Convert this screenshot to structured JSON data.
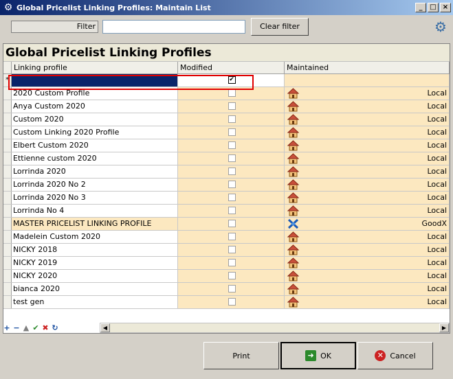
{
  "window": {
    "title": "Global Pricelist Linking Profiles: Maintain List",
    "app_icon": "gear-icon"
  },
  "filter": {
    "label": "Filter",
    "value": "",
    "clear_label": "Clear filter"
  },
  "panel": {
    "title": "Global Pricelist Linking Profiles"
  },
  "grid": {
    "columns": [
      "Linking profile",
      "Modified",
      "Maintained"
    ],
    "new_row": {
      "indicator": "*",
      "modified": true
    },
    "rows": [
      {
        "profile": "2020 Custom Profile",
        "modified": false,
        "maintained": "Local",
        "icon": "house-icon"
      },
      {
        "profile": "Anya Custom 2020",
        "modified": false,
        "maintained": "Local",
        "icon": "house-icon"
      },
      {
        "profile": "Custom 2020",
        "modified": false,
        "maintained": "Local",
        "icon": "house-icon"
      },
      {
        "profile": "Custom Linking 2020 Profile",
        "modified": false,
        "maintained": "Local",
        "icon": "house-icon"
      },
      {
        "profile": "Elbert Custom 2020",
        "modified": false,
        "maintained": "Local",
        "icon": "house-icon"
      },
      {
        "profile": "Ettienne custom 2020",
        "modified": false,
        "maintained": "Local",
        "icon": "house-icon"
      },
      {
        "profile": "Lorrinda 2020",
        "modified": false,
        "maintained": "Local",
        "icon": "house-icon"
      },
      {
        "profile": "Lorrinda 2020 No 2",
        "modified": false,
        "maintained": "Local",
        "icon": "house-icon"
      },
      {
        "profile": "Lorrinda 2020 No 3",
        "modified": false,
        "maintained": "Local",
        "icon": "house-icon"
      },
      {
        "profile": "Lorrinda No 4",
        "modified": false,
        "maintained": "Local",
        "icon": "house-icon"
      },
      {
        "profile": "MASTER PRICELIST LINKING PROFILE",
        "modified": false,
        "maintained": "GoodX",
        "icon": "goodx-icon",
        "highlight": true
      },
      {
        "profile": "Madelein Custom 2020",
        "modified": false,
        "maintained": "Local",
        "icon": "house-icon"
      },
      {
        "profile": "NICKY 2018",
        "modified": false,
        "maintained": "Local",
        "icon": "house-icon"
      },
      {
        "profile": "NICKY 2019",
        "modified": false,
        "maintained": "Local",
        "icon": "house-icon"
      },
      {
        "profile": "NICKY 2020",
        "modified": false,
        "maintained": "Local",
        "icon": "house-icon"
      },
      {
        "profile": "bianca 2020",
        "modified": false,
        "maintained": "Local",
        "icon": "house-icon"
      },
      {
        "profile": "test gen",
        "modified": false,
        "maintained": "Local",
        "icon": "house-icon"
      }
    ]
  },
  "navigator": {
    "icons": [
      "plus-icon",
      "minus-icon",
      "up-icon",
      "check-icon",
      "cross-icon",
      "refresh-icon"
    ]
  },
  "footer": {
    "print_label": "Print",
    "ok_label": "OK",
    "cancel_label": "Cancel"
  }
}
